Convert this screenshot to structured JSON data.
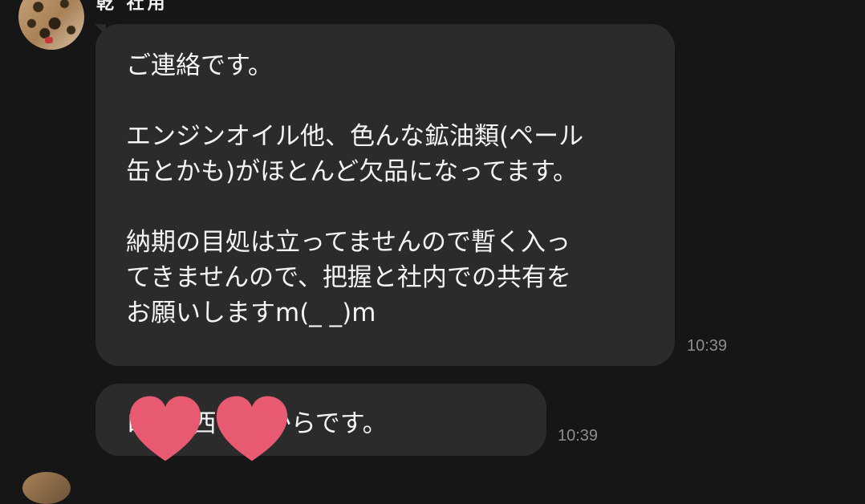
{
  "conversation": {
    "sender_name": "乾 社用",
    "messages": [
      {
        "paragraphs": [
          "ご連絡です。",
          "エンジンオイル他、色んな鉱油類(ペール\n缶とかも)がほとんど欠品になってます。",
          "納期の目処は立ってませんので暫く入っ\nてきませんので、把握と社内での共有を\nお願いしますm(_ _)m"
        ],
        "time": "10:39"
      },
      {
        "text": "ロ パ 西さんからです。",
        "time": "10:39"
      }
    ]
  },
  "stickers": [
    "heart-sticker",
    "heart-sticker"
  ],
  "colors": {
    "background": "#161617",
    "bubble": "#2b2b2c",
    "heart": "#e85a72",
    "timestamp": "#8d8d8f"
  }
}
